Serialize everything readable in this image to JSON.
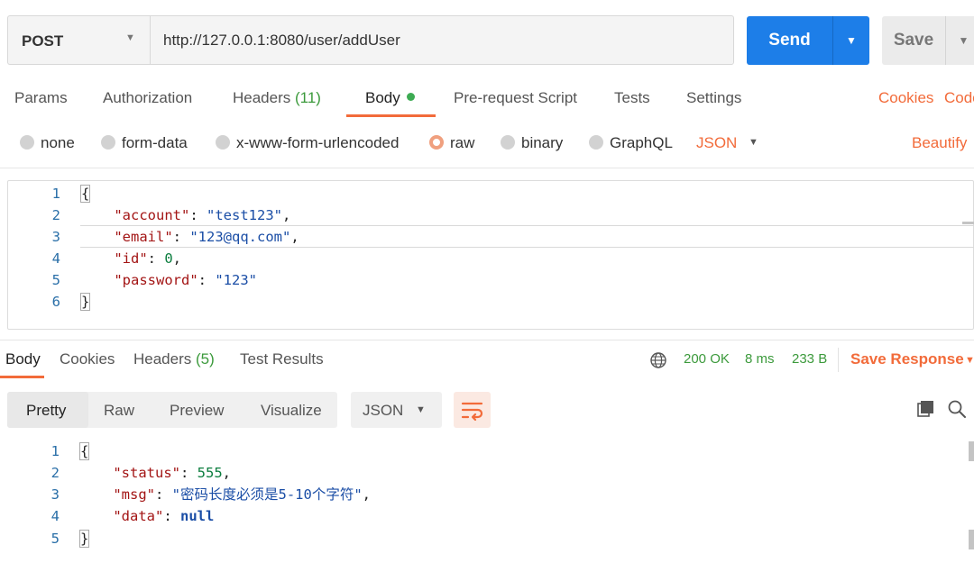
{
  "request": {
    "method": "POST",
    "url": "http://127.0.0.1:8080/user/addUser",
    "send_label": "Send",
    "save_label": "Save"
  },
  "request_tabs": {
    "params": "Params",
    "authorization": "Authorization",
    "headers": "Headers",
    "headers_count": "(11)",
    "body": "Body",
    "prerequest": "Pre-request Script",
    "tests": "Tests",
    "settings": "Settings",
    "cookies": "Cookies",
    "code": "Code"
  },
  "body_modes": {
    "none": "none",
    "form_data": "form-data",
    "urlencoded": "x-www-form-urlencoded",
    "raw": "raw",
    "binary": "binary",
    "graphql": "GraphQL",
    "format": "JSON",
    "selected": "raw",
    "beautify": "Beautify"
  },
  "request_body": {
    "line_numbers": [
      "1",
      "2",
      "3",
      "4",
      "5",
      "6"
    ],
    "open": "{",
    "close": "}",
    "fields": [
      {
        "key": "\"account\"",
        "value": "\"test123\"",
        "type": "string"
      },
      {
        "key": "\"email\"",
        "value": "\"123@qq.com\"",
        "type": "string"
      },
      {
        "key": "\"id\"",
        "value": "0",
        "type": "number"
      },
      {
        "key": "\"password\"",
        "value": "\"123\"",
        "type": "string"
      }
    ]
  },
  "response_tabs": {
    "body": "Body",
    "cookies": "Cookies",
    "headers": "Headers",
    "headers_count": "(5)",
    "test_results": "Test Results"
  },
  "response_meta": {
    "status": "200 OK",
    "time": "8 ms",
    "size": "233 B",
    "save_response": "Save Response"
  },
  "response_view": {
    "pretty": "Pretty",
    "raw": "Raw",
    "preview": "Preview",
    "visualize": "Visualize",
    "format": "JSON"
  },
  "response_body": {
    "line_numbers": [
      "1",
      "2",
      "3",
      "4",
      "5"
    ],
    "open": "{",
    "close": "}",
    "fields": [
      {
        "key": "\"status\"",
        "value": "555",
        "type": "number"
      },
      {
        "key": "\"msg\"",
        "value": "\"密码长度必须是5-10个字符\"",
        "type": "string"
      },
      {
        "key": "\"data\"",
        "value": "null",
        "type": "keyword"
      }
    ]
  },
  "colors": {
    "accent": "#f26b3a",
    "send_blue": "#1d7ee8",
    "status_green": "#3c9a3c"
  }
}
